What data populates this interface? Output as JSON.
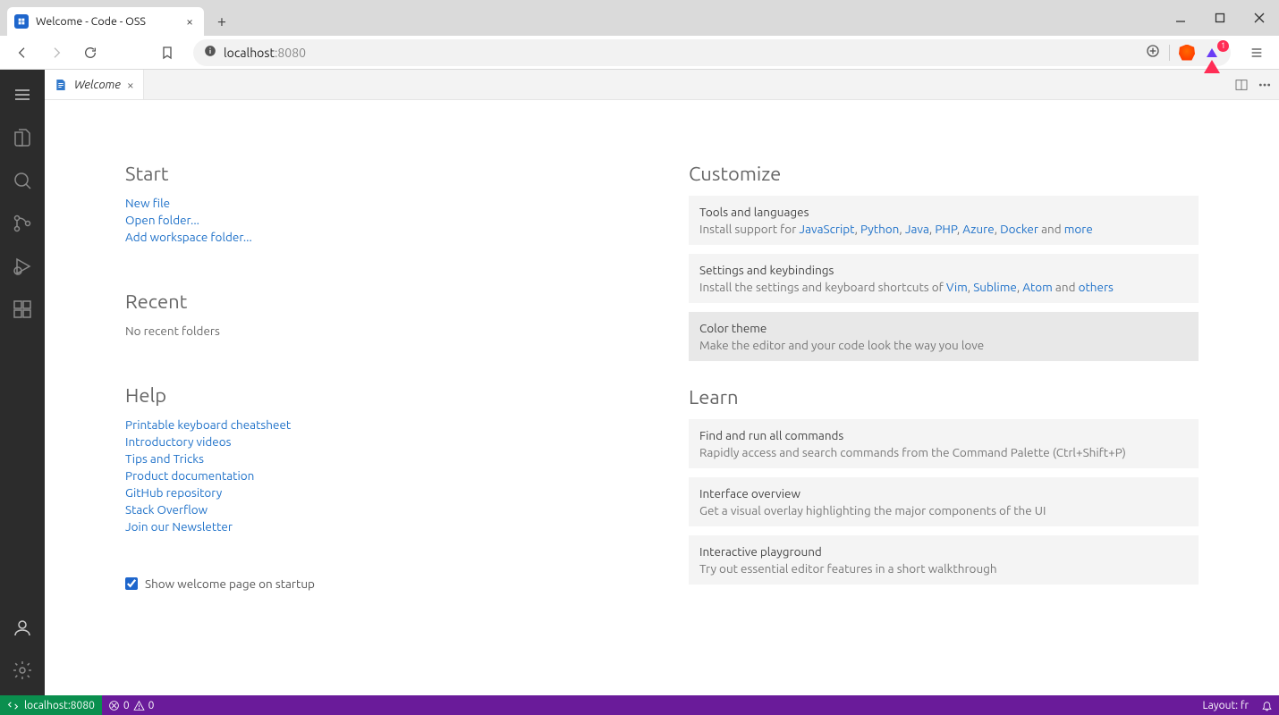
{
  "browser": {
    "tab_title": "Welcome - Code - OSS",
    "new_tab_label": "+",
    "badge_count": "1",
    "url_host": "localhost",
    "url_port": ":8080"
  },
  "editor": {
    "tab_label": "Welcome"
  },
  "welcome": {
    "start": {
      "heading": "Start",
      "new_file": "New file",
      "open_folder": "Open folder...",
      "add_workspace": "Add workspace folder..."
    },
    "recent": {
      "heading": "Recent",
      "empty": "No recent folders"
    },
    "help": {
      "heading": "Help",
      "links": {
        "cheatsheet": "Printable keyboard cheatsheet",
        "videos": "Introductory videos",
        "tips": "Tips and Tricks",
        "docs": "Product documentation",
        "github": "GitHub repository",
        "stackoverflow": "Stack Overflow",
        "newsletter": "Join our Newsletter"
      }
    },
    "startup_label": "Show welcome page on startup",
    "customize": {
      "heading": "Customize",
      "tools": {
        "title": "Tools and languages",
        "prefix": "Install support for ",
        "js": "JavaScript",
        "python": "Python",
        "java": "Java",
        "php": "PHP",
        "azure": "Azure",
        "docker": "Docker",
        "and": " and ",
        "more": "more",
        "sep": ", "
      },
      "settings": {
        "title": "Settings and keybindings",
        "prefix": "Install the settings and keyboard shortcuts of ",
        "vim": "Vim",
        "sublime": "Sublime",
        "atom": "Atom",
        "and": " and ",
        "others": "others",
        "sep": ", "
      },
      "theme": {
        "title": "Color theme",
        "desc": "Make the editor and your code look the way you love"
      }
    },
    "learn": {
      "heading": "Learn",
      "commands": {
        "title": "Find and run all commands",
        "desc": "Rapidly access and search commands from the Command Palette (Ctrl+Shift+P)"
      },
      "overview": {
        "title": "Interface overview",
        "desc": "Get a visual overlay highlighting the major components of the UI"
      },
      "playground": {
        "title": "Interactive playground",
        "desc": "Try out essential editor features in a short walkthrough"
      }
    }
  },
  "status": {
    "remote": "localhost:8080",
    "errors": "0",
    "warnings": "0",
    "layout": "Layout: fr"
  }
}
